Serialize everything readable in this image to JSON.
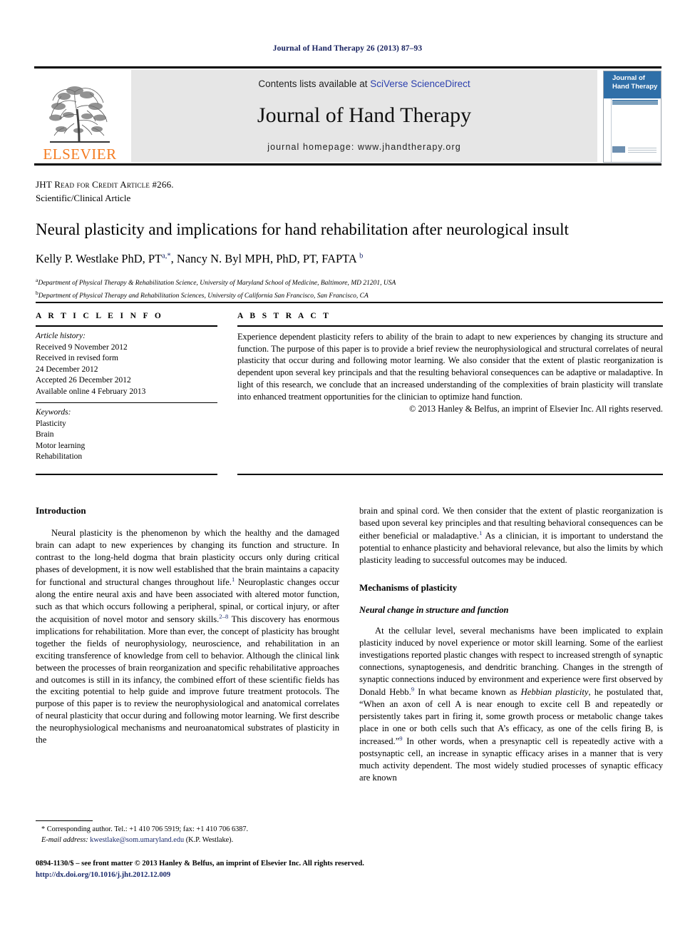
{
  "running_head": "Journal of Hand Therapy 26 (2013) 87–93",
  "masthead": {
    "contents_prefix": "Contents lists available at ",
    "sciencedirect_link": "SciVerse ScienceDirect",
    "journal_name": "Journal of Hand Therapy",
    "homepage": "journal homepage: www.jhandtherapy.org",
    "publisher_wordmark": "ELSEVIER",
    "publisher_color": "#f47b20",
    "link_color": "#2b3fae",
    "cover_title_line1": "Journal of",
    "cover_title_line2": "Hand Therapy",
    "cover_banner_color": "#2f6fa8"
  },
  "article": {
    "read_for_credit": "JHT Read for Credit Article #266.",
    "type": "Scientific/Clinical Article",
    "title": "Neural plasticity and implications for hand rehabilitation after neurological insult",
    "authors": "Kelly P. Westlake PhD, PT",
    "author1_marks": "a,*",
    "authors_cont": ", Nancy N. Byl MPH, PhD, PT, FAPTA ",
    "author2_mark": "b",
    "affiliation_a_mark": "a",
    "affiliation_a": "Department of Physical Therapy & Rehabilitation Science, University of Maryland School of Medicine, Baltimore, MD 21201, USA",
    "affiliation_b_mark": "b",
    "affiliation_b": "Department of Physical Therapy and Rehabilitation Sciences, University of California San Francisco, San Francisco, CA"
  },
  "info": {
    "label": "A R T I C L E    I N F O",
    "history_label": "Article history:",
    "history": [
      "Received 9 November 2012",
      "Received in revised form",
      "24 December 2012",
      "Accepted 26 December 2012",
      "Available online 4 February 2013"
    ],
    "keywords_label": "Keywords:",
    "keywords": [
      "Plasticity",
      "Brain",
      "Motor learning",
      "Rehabilitation"
    ]
  },
  "abstract": {
    "label": "A B S T R A C T",
    "text": "Experience dependent plasticity refers to ability of the brain to adapt to new experiences by changing its structure and function. The purpose of this paper is to provide a brief review the neurophysiological and structural correlates of neural plasticity that occur during and following motor learning. We also consider that the extent of plastic reorganization is dependent upon several key principals and that the resulting behavioral consequences can be adaptive or maladaptive. In light of this research, we conclude that an increased understanding of the complexities of brain plasticity will translate into enhanced treatment opportunities for the clinician to optimize hand function.",
    "copyright": "© 2013 Hanley & Belfus, an imprint of Elsevier Inc. All rights reserved."
  },
  "body": {
    "left": {
      "heading": "Introduction",
      "p1_a": "Neural plasticity is the phenomenon by which the healthy and the damaged brain can adapt to new experiences by changing its function and structure. In contrast to the long-held dogma that brain plasticity occurs only during critical phases of development, it is now well established that the brain maintains a capacity for functional and structural changes throughout life.",
      "p1_ref1": "1",
      "p1_b": " Neuroplastic changes occur along the entire neural axis and have been associated with altered motor function, such as that which occurs following a peripheral, spinal, or cortical injury, or after the acquisition of novel motor and sensory skills.",
      "p1_ref2": "2–8",
      "p1_c": " This discovery has enormous implications for rehabilitation. More than ever, the concept of plasticity has brought together the fields of neurophysiology, neuroscience, and rehabilitation in an exciting transference of knowledge from cell to behavior. Although the clinical link between the processes of brain reorganization and specific rehabilitative approaches and outcomes is still in its infancy, the combined effort of these scientific fields has the exciting potential to help guide and improve future treatment protocols. The purpose of this paper is to review the neurophysiological and anatomical correlates of neural plasticity that occur during and following motor learning. We first describe the neurophysiological mechanisms and neuroanatomical substrates of plasticity in the"
    },
    "right": {
      "p1_a": "brain and spinal cord. We then consider that the extent of plastic reorganization is based upon several key principles and that resulting behavioral consequences can be either beneficial or maladaptive.",
      "p1_ref": "1",
      "p1_b": " As a clinician, it is important to understand the potential to enhance plasticity and behavioral relevance, but also the limits by which plasticity leading to successful outcomes may be induced.",
      "heading2": "Mechanisms of plasticity",
      "subheading": "Neural change in structure and function",
      "p2_a": "At the cellular level, several mechanisms have been implicated to explain plasticity induced by novel experience or motor skill learning. Some of the earliest investigations reported plastic changes with respect to increased strength of synaptic connections, synaptogenesis, and dendritic branching. Changes in the strength of synaptic connections induced by environment and experience were first observed by Donald Hebb.",
      "p2_ref1": "9",
      "p2_b": " In what became known as ",
      "p2_italic": "Hebbian plasticity",
      "p2_c": ", he postulated that, “When an axon of cell A is near enough to excite cell B and repeatedly or persistently takes part in firing it, some growth process or metabolic change takes place in one or both cells such that A’s efficacy, as one of the cells firing B, is increased.”",
      "p2_ref2": "9",
      "p2_d": " In other words, when a presynaptic cell is repeatedly active with a postsynaptic cell, an increase in synaptic efficacy arises in a manner that is very much activity dependent. The most widely studied processes of synaptic efficacy are known"
    }
  },
  "footnote": {
    "corresponding": "* Corresponding author. Tel.: +1 410 706 5919; fax: +1 410 706 6387.",
    "email_label": "E-mail address:",
    "email": "kwestlake@som.umaryland.edu",
    "email_suffix": " (K.P. Westlake)."
  },
  "page_footer": {
    "line1": "0894-1130/$ – see front matter © 2013 Hanley & Belfus, an imprint of Elsevier Inc. All rights reserved.",
    "doi": "http://dx.doi.org/10.1016/j.jht.2012.12.009"
  }
}
